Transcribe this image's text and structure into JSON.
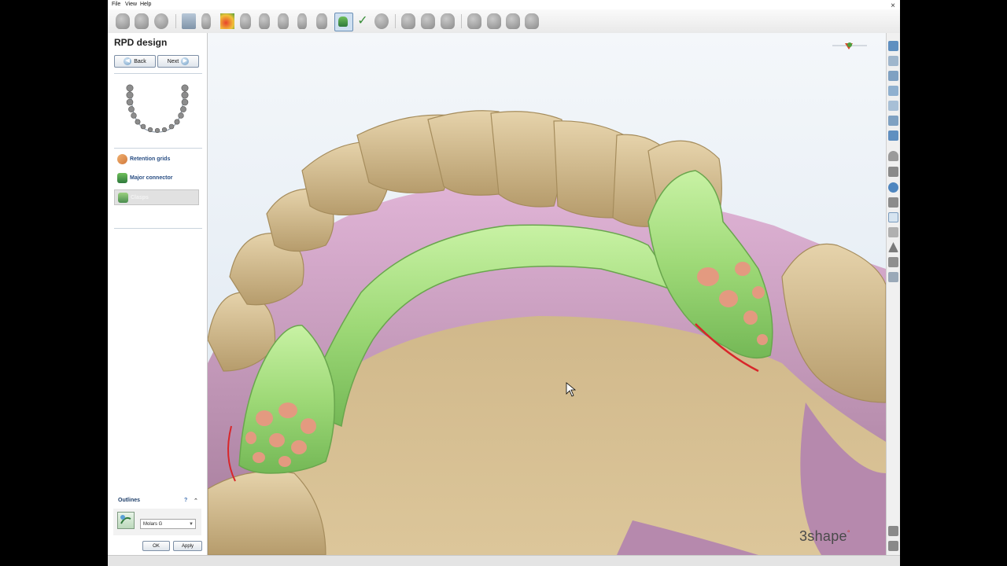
{
  "menu": {
    "file": "File",
    "view": "View",
    "help": "Help"
  },
  "window": {
    "close": "×"
  },
  "toolbar": {
    "icons": [
      "arrow-down-icon",
      "model-icon",
      "disc-icon",
      "scanner-icon",
      "tooth-icon",
      "paint-icon",
      "tooth-icon",
      "tooth-icon",
      "tooth-icon",
      "tooth-icon",
      "tooth-icon",
      "rpd-icon",
      "check-icon",
      "globe-icon",
      "move-icon",
      "sculpt-icon",
      "sculpt-icon",
      "measure-icon",
      "measure-icon",
      "measure-icon",
      "cut-icon"
    ]
  },
  "panel": {
    "title": "RPD design",
    "back_label": "Back",
    "next_label": "Next",
    "steps": [
      {
        "label": "Retention grids",
        "icon": "retention-grid-icon"
      },
      {
        "label": "Major connector",
        "icon": "major-connector-icon"
      },
      {
        "label": "Clasps",
        "icon": "clasp-icon",
        "active": true
      }
    ],
    "outlines": {
      "title": "Outlines",
      "help": "?",
      "collapse": "⌃",
      "selected": "Molars G"
    },
    "ok_label": "OK",
    "apply_label": "Apply"
  },
  "viewport": {
    "logo": "3shape"
  },
  "colors": {
    "model": "#d6c096",
    "gingiva": "#c9a0c4",
    "framework": "#a6e07f",
    "accent": "#e55d3c"
  },
  "rightbar": {
    "icons": [
      "view-front-icon",
      "view-back-icon",
      "view-left-icon",
      "view-right-icon",
      "view-top-icon",
      "view-bottom-icon",
      "view-iso-icon",
      "clip-icon",
      "section-icon",
      "pen-icon",
      "print-icon",
      "visibility-icon",
      "transparency-icon",
      "warning-icon",
      "cube-icon",
      "axis-icon",
      "measure-icon",
      "snapshot-icon"
    ]
  }
}
